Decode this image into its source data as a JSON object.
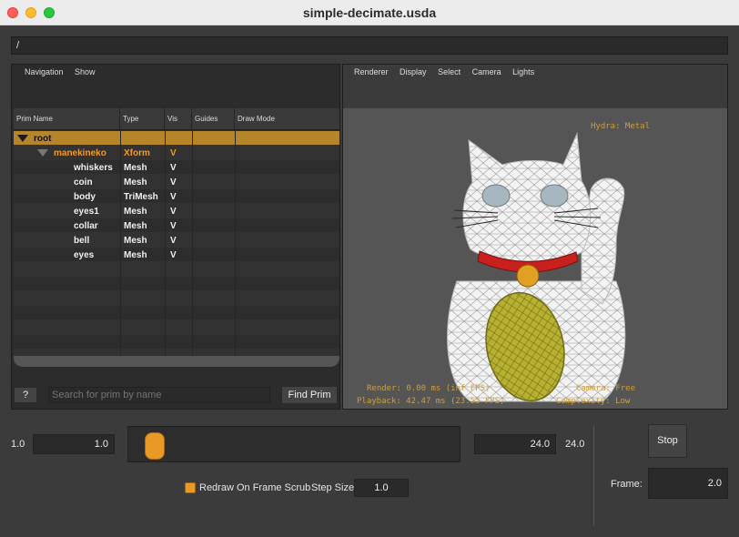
{
  "window": {
    "title": "simple-decimate.usda"
  },
  "path_bar": {
    "value": "/"
  },
  "browser": {
    "menus": [
      "Navigation",
      "Show"
    ],
    "columns": [
      "Prim Name",
      "Type",
      "Vis",
      "Guides",
      "Draw Mode"
    ],
    "rows": [
      {
        "name": "root",
        "type": "",
        "vis": "",
        "level": 0,
        "expanded": true,
        "selected": true,
        "highlight": false
      },
      {
        "name": "manekineko",
        "type": "Xform",
        "vis": "V",
        "level": 1,
        "expanded": true,
        "selected": false,
        "highlight": true
      },
      {
        "name": "whiskers",
        "type": "Mesh",
        "vis": "V",
        "level": 2,
        "selected": false,
        "highlight": false
      },
      {
        "name": "coin",
        "type": "Mesh",
        "vis": "V",
        "level": 2,
        "selected": false,
        "highlight": false
      },
      {
        "name": "body",
        "type": "TriMesh",
        "vis": "V",
        "level": 2,
        "selected": false,
        "highlight": false
      },
      {
        "name": "eyes1",
        "type": "Mesh",
        "vis": "V",
        "level": 2,
        "selected": false,
        "highlight": false
      },
      {
        "name": "collar",
        "type": "Mesh",
        "vis": "V",
        "level": 2,
        "selected": false,
        "highlight": false
      },
      {
        "name": "bell",
        "type": "Mesh",
        "vis": "V",
        "level": 2,
        "selected": false,
        "highlight": false
      },
      {
        "name": "eyes",
        "type": "Mesh",
        "vis": "V",
        "level": 2,
        "selected": false,
        "highlight": false
      }
    ],
    "help_label": "?",
    "search_placeholder": "Search for prim by name",
    "find_label": "Find Prim"
  },
  "viewport": {
    "menus": [
      "Renderer",
      "Display",
      "Select",
      "Camera",
      "Lights"
    ],
    "renderer_label": "Hydra: Metal",
    "render_stats": "Render: 0.00 ms (inf FPS)",
    "playback_stats": "Playback: 42.47 ms (23.55 FPS)",
    "camera_label": "Camera: Free",
    "complexity_label": "Complexity: Low"
  },
  "timeline": {
    "start_label": "1.0",
    "start_value": "1.0",
    "end_value": "24.0",
    "end_label": "24.0",
    "redraw_label": "Redraw On Frame Scrub",
    "redraw_checked": true,
    "step_size_label": "Step Size",
    "step_size_value": "1.0",
    "stop_label": "Stop",
    "frame_label": "Frame:",
    "frame_value": "2.0",
    "slider_fraction": 0.043
  },
  "colors": {
    "accent": "#e89a25",
    "selection": "#b5852c",
    "overlay_text": "#c9a042"
  }
}
